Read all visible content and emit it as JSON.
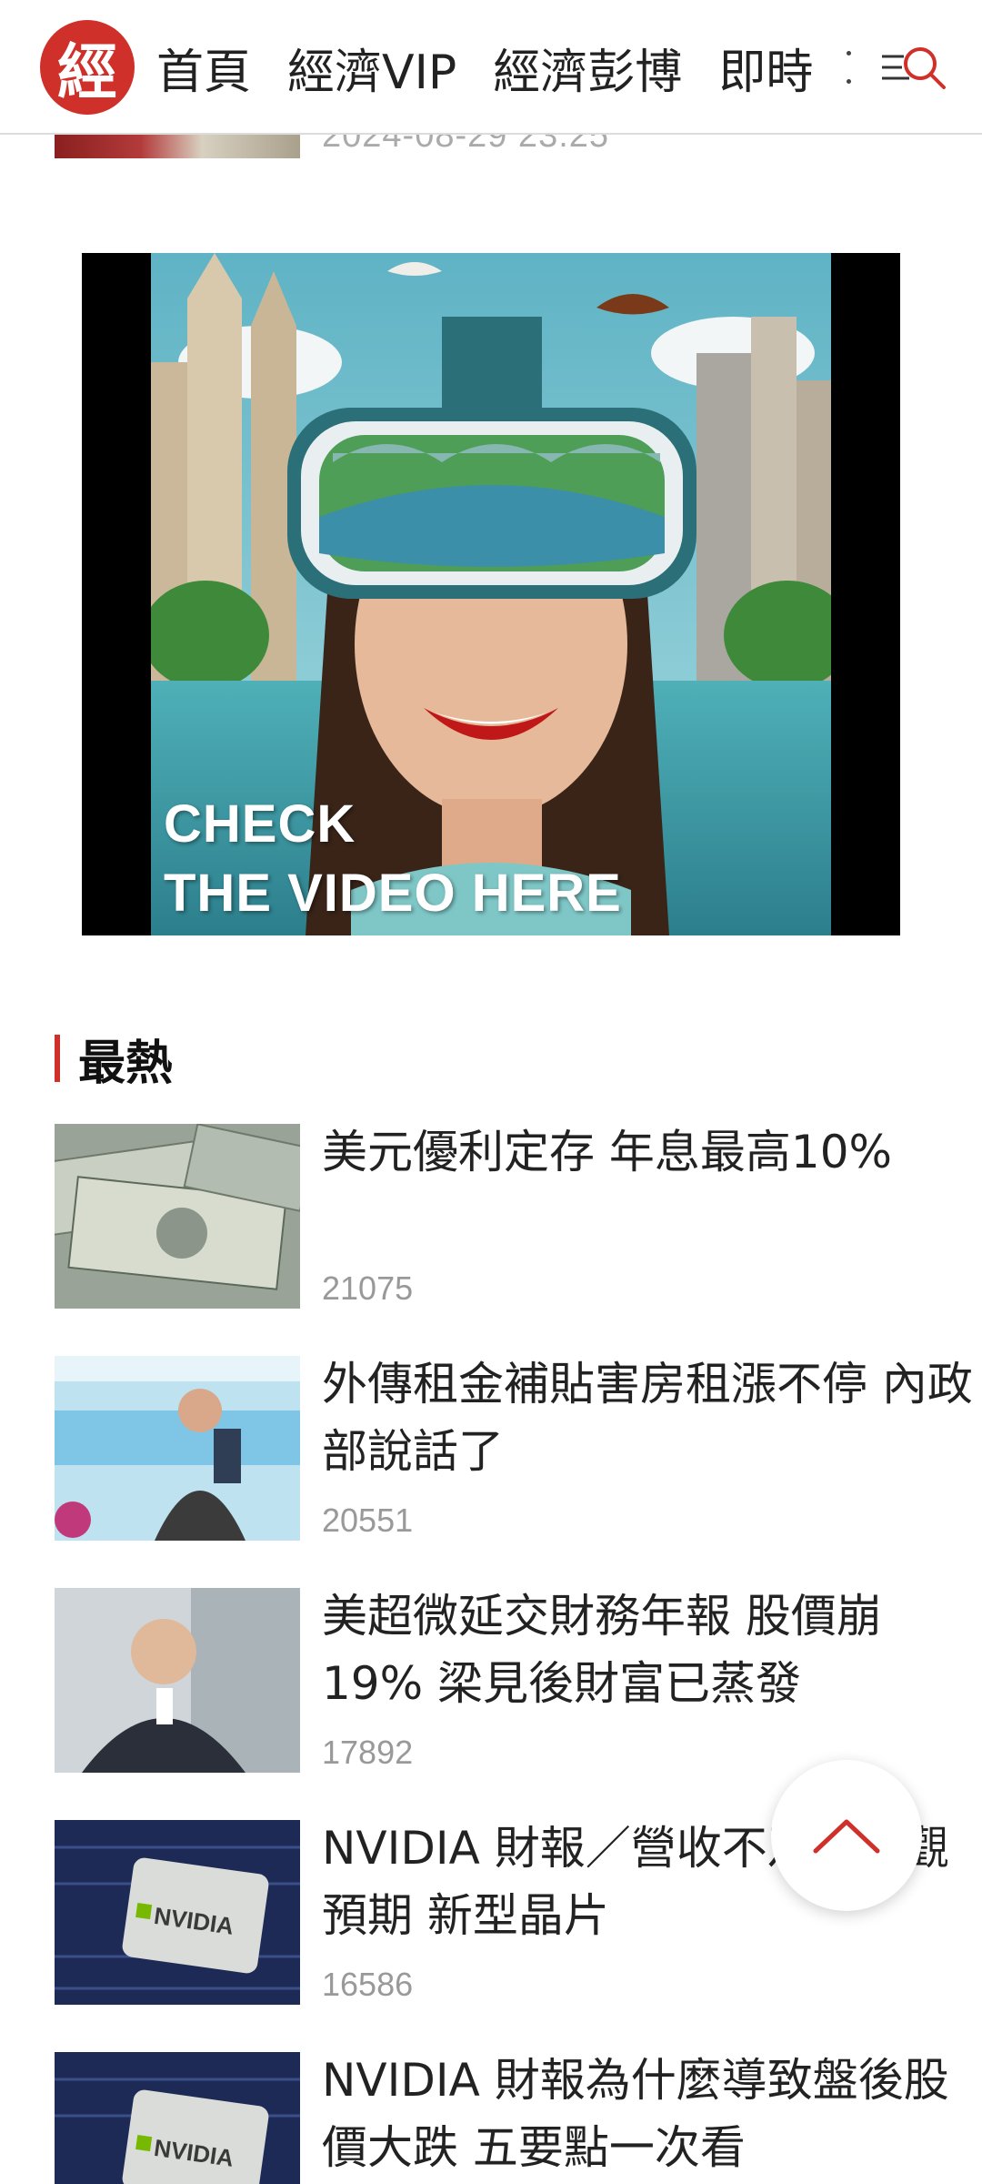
{
  "header": {
    "logo_char": "經",
    "nav": [
      "首頁",
      "經濟VIP",
      "經濟彭博",
      "即時"
    ],
    "menu_icon": "menu-search-icon"
  },
  "previous_item": {
    "date": "2024-08-29 23:25"
  },
  "ad": {
    "lines": [
      "CHECK",
      "THE VIDEO HERE"
    ]
  },
  "section": {
    "title": "最熱"
  },
  "articles": [
    {
      "title": "美元優利定存 年息最高10%",
      "count": "21075"
    },
    {
      "title": "外傳租金補貼害房租漲不停 內政部說話了",
      "count": "20551"
    },
    {
      "title": "美超微延交財務年報 股價崩19% 梁見後財富已蒸發",
      "count": "17892"
    },
    {
      "title": "NVIDIA 財報／營收不及最樂觀預期 新型晶片",
      "count": "16586"
    },
    {
      "title": "NVIDIA 財報為什麼導致盤後股價大跌 五要點一次看",
      "count": ""
    }
  ],
  "colors": {
    "brand": "#d0302a",
    "text": "#222222",
    "muted": "#999999"
  }
}
